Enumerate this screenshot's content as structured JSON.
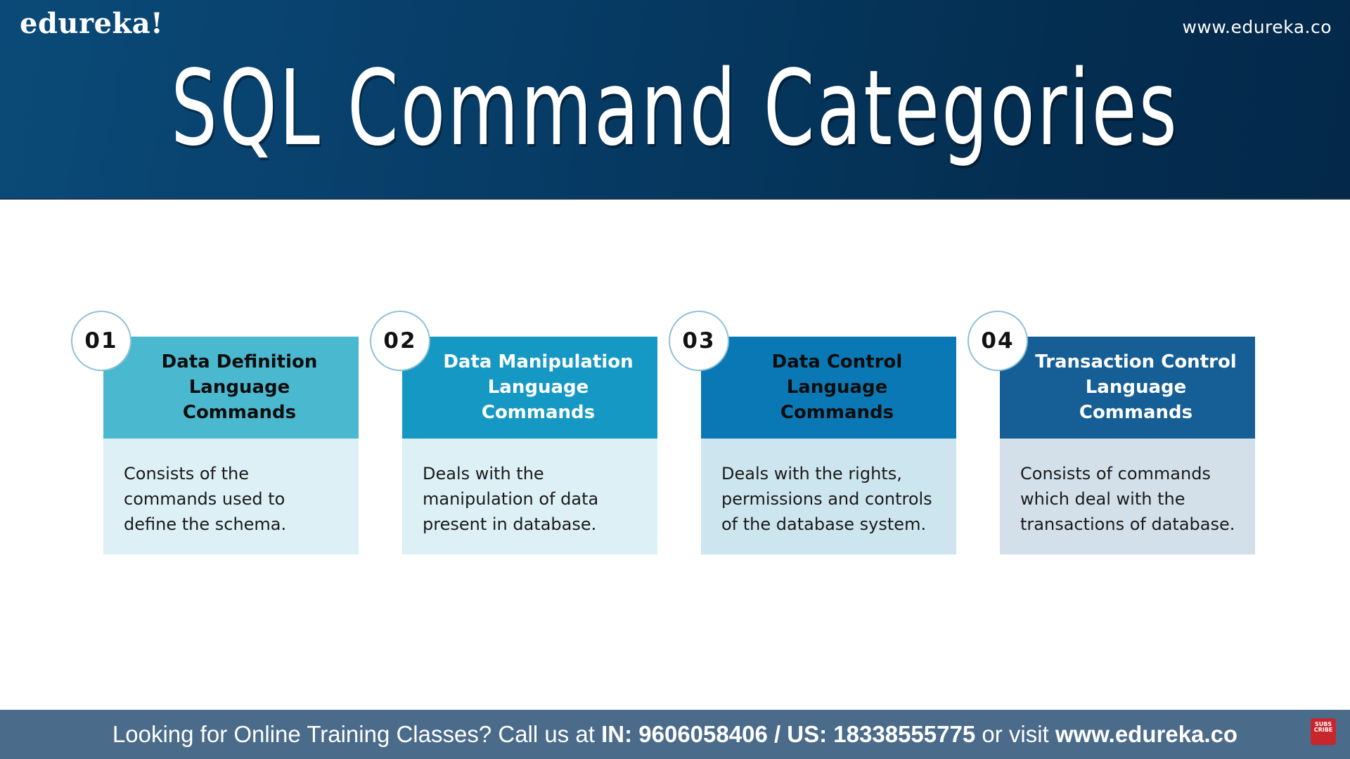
{
  "header": {
    "logo": "edureka!",
    "site_url": "www.edureka.co",
    "title": "SQL Command Categories",
    "background_color": "#063a63"
  },
  "cards": [
    {
      "number": "01",
      "title": "Data Definition Language Commands",
      "description": "Consists of the commands used to define the schema.",
      "head_color": "#4ab8cf",
      "head_text_color": "#0d0d0d",
      "body_color": "#dcf0f5"
    },
    {
      "number": "02",
      "title": "Data Manipulation Language Commands",
      "description": "Deals with the manipulation of data present in database.",
      "head_color": "#1599c4",
      "head_text_color": "#ffffff",
      "body_color": "#dcf0f5"
    },
    {
      "number": "03",
      "title": "Data Control Language Commands",
      "description": "Deals with the rights, permissions and controls of the database system.",
      "head_color": "#0a78b5",
      "head_text_color": "#0d0d0d",
      "body_color": "#cde5ee"
    },
    {
      "number": "04",
      "title": "Transaction Control Language Commands",
      "description": "Consists of commands which deal with the transactions of database.",
      "head_color": "#155f96",
      "head_text_color": "#ffffff",
      "body_color": "#d3e0ea"
    }
  ],
  "footer": {
    "prefix": "Looking for Online Training Classes? Call us at ",
    "phones": "IN: 9606058406 / US: 18338555775",
    "middle": " or visit ",
    "url": "www.edureka.co",
    "subscribe_label": "SUBS CRIBE",
    "background_color": "#4a6b8a"
  }
}
